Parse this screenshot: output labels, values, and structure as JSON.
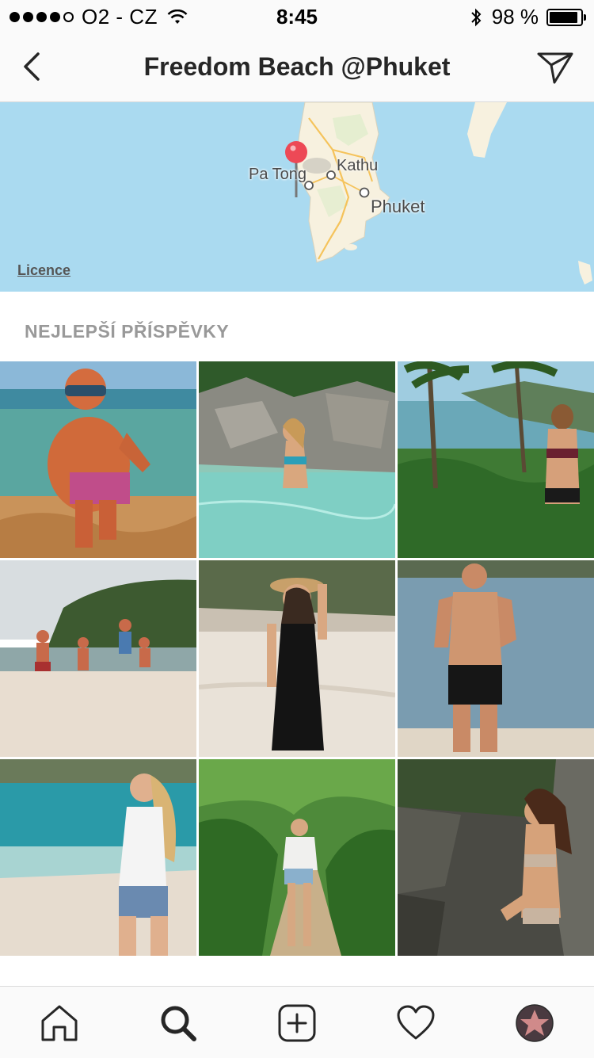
{
  "status_bar": {
    "carrier": "O2 - CZ",
    "time": "8:45",
    "battery": "98 %",
    "battery_level": 0.98,
    "signal_bars_filled": 4,
    "signal_bars_total": 5
  },
  "header": {
    "title": "Freedom Beach @Phuket",
    "back_icon": "chevron-left-icon",
    "share_icon": "paper-plane-icon"
  },
  "map": {
    "labels": {
      "pa_tong": "Pa Tong",
      "kathu": "Kathu",
      "phuket": "Phuket"
    },
    "licence": "Licence",
    "pin_color": "#ed4956",
    "water_color": "#aadaf0",
    "land_color": "#f7f1df"
  },
  "section": {
    "title": "NEJLEPŠÍ PŘÍSPĚVKY"
  },
  "posts": [
    {
      "id": "post-1",
      "scene": "man-in-sea-sunglasses"
    },
    {
      "id": "post-2",
      "scene": "woman-in-lagoon-rocks"
    },
    {
      "id": "post-3",
      "scene": "woman-palms-bay-view"
    },
    {
      "id": "post-4",
      "scene": "group-jumping-on-beach"
    },
    {
      "id": "post-5",
      "scene": "woman-black-dress-hat"
    },
    {
      "id": "post-6",
      "scene": "man-shirtless-sea"
    },
    {
      "id": "post-7",
      "scene": "woman-white-top-beach"
    },
    {
      "id": "post-8",
      "scene": "woman-jungle-path"
    },
    {
      "id": "post-9",
      "scene": "woman-bikini-rocks"
    }
  ],
  "tab_bar": {
    "items": [
      {
        "name": "tab-home",
        "icon": "home-icon"
      },
      {
        "name": "tab-search",
        "icon": "search-icon"
      },
      {
        "name": "tab-add",
        "icon": "plus-square-icon"
      },
      {
        "name": "tab-activity",
        "icon": "heart-icon"
      },
      {
        "name": "tab-profile",
        "icon": "avatar"
      }
    ]
  }
}
